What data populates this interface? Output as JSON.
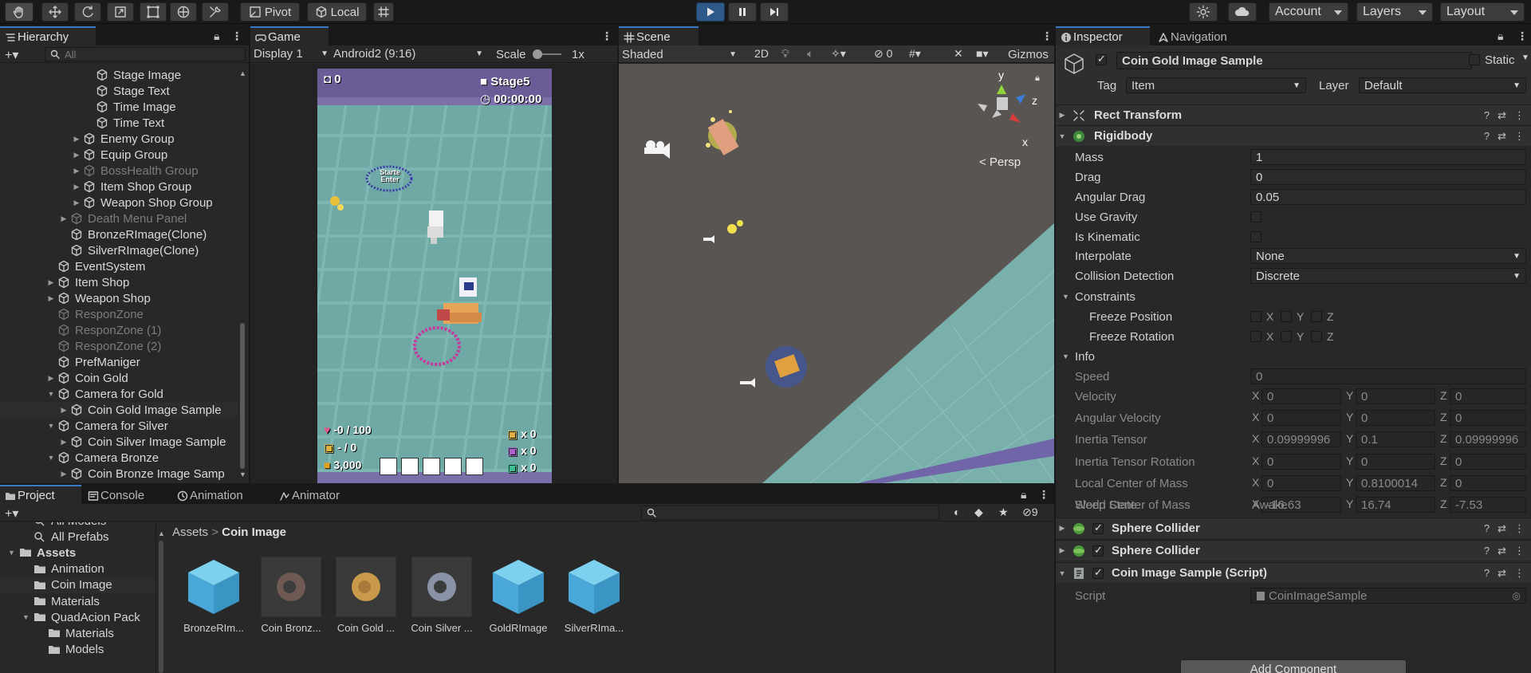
{
  "toolbar": {
    "pivot": "Pivot",
    "local": "Local",
    "account": "Account",
    "layers": "Layers",
    "layout": "Layout"
  },
  "hierarchy": {
    "tab": "Hierarchy",
    "search_placeholder": "All",
    "items": [
      {
        "label": "Stage Image",
        "indent": 3,
        "expand": false,
        "dim": false
      },
      {
        "label": "Stage Text",
        "indent": 3,
        "expand": false,
        "dim": false
      },
      {
        "label": "Time Image",
        "indent": 3,
        "expand": false,
        "dim": false
      },
      {
        "label": "Time Text",
        "indent": 3,
        "expand": false,
        "dim": false
      },
      {
        "label": "Enemy Group",
        "indent": 2,
        "expand": true,
        "dim": false
      },
      {
        "label": "Equip Group",
        "indent": 2,
        "expand": true,
        "dim": false
      },
      {
        "label": "BossHealth Group",
        "indent": 2,
        "expand": true,
        "dim": true
      },
      {
        "label": "Item Shop Group",
        "indent": 2,
        "expand": true,
        "dim": false
      },
      {
        "label": "Weapon Shop Group",
        "indent": 2,
        "expand": true,
        "dim": false
      },
      {
        "label": "Death Menu Panel",
        "indent": 1,
        "expand": true,
        "dim": true
      },
      {
        "label": "BronzeRImage(Clone)",
        "indent": 1,
        "expand": false,
        "dim": false
      },
      {
        "label": "SilverRImage(Clone)",
        "indent": 1,
        "expand": false,
        "dim": false
      },
      {
        "label": "EventSystem",
        "indent": 0,
        "expand": false,
        "dim": false
      },
      {
        "label": "Item Shop",
        "indent": 0,
        "expand": true,
        "dim": false
      },
      {
        "label": "Weapon Shop",
        "indent": 0,
        "expand": true,
        "dim": false
      },
      {
        "label": "ResponZone",
        "indent": 0,
        "expand": false,
        "dim": true
      },
      {
        "label": "ResponZone (1)",
        "indent": 0,
        "expand": false,
        "dim": true
      },
      {
        "label": "ResponZone (2)",
        "indent": 0,
        "expand": false,
        "dim": true
      },
      {
        "label": "PrefManiger",
        "indent": 0,
        "expand": false,
        "dim": false
      },
      {
        "label": "Coin Gold",
        "indent": 0,
        "expand": true,
        "dim": false
      },
      {
        "label": "Camera for Gold",
        "indent": 0,
        "expand": "open",
        "dim": false
      },
      {
        "label": "Coin Gold Image Sample",
        "indent": 1,
        "expand": true,
        "dim": false,
        "sel": true
      },
      {
        "label": "Camera for Silver",
        "indent": 0,
        "expand": "open",
        "dim": false
      },
      {
        "label": "Coin Silver Image Sample",
        "indent": 1,
        "expand": true,
        "dim": false
      },
      {
        "label": "Camera Bronze",
        "indent": 0,
        "expand": "open",
        "dim": false
      },
      {
        "label": "Coin Bronze Image Samp",
        "indent": 1,
        "expand": true,
        "dim": false
      }
    ]
  },
  "game": {
    "tab": "Game",
    "display": "Display 1",
    "resolution": "Android2 (9:16)",
    "scale_label": "Scale",
    "scale_value": "1x",
    "hud_hearts": "0",
    "hud_stage": "Stage5",
    "hud_time": "00:00:00",
    "hud_sign": "Starte Enter",
    "hud_health": "-0 / 100",
    "hud_ammo": "- / 0",
    "hud_coins": "3,000",
    "hud_x1": "x 0",
    "hud_x2": "x 0",
    "hud_x3": "x 0"
  },
  "scene": {
    "tab": "Scene",
    "shading": "Shaded",
    "mode2d": "2D",
    "hidden_count": "0",
    "gizmos": "Gizmos",
    "persp": "< Persp",
    "axis_y": "y",
    "axis_z": "z",
    "axis_x": "x"
  },
  "project": {
    "tabs": [
      "Project",
      "Console",
      "Animation",
      "Animator"
    ],
    "hidden_count": "9",
    "tree": [
      {
        "label": "All Models",
        "indent": 1,
        "icon": "search",
        "cut": true
      },
      {
        "label": "All Prefabs",
        "indent": 1,
        "icon": "search"
      },
      {
        "label": "Assets",
        "indent": 0,
        "icon": "folder",
        "open": true,
        "bold": true
      },
      {
        "label": "Animation",
        "indent": 1,
        "icon": "folder"
      },
      {
        "label": "Coin Image",
        "indent": 1,
        "icon": "folder",
        "sel": true
      },
      {
        "label": "Materials",
        "indent": 1,
        "icon": "folder"
      },
      {
        "label": "QuadAcion Pack",
        "indent": 1,
        "icon": "folder",
        "open": true
      },
      {
        "label": "Materials",
        "indent": 2,
        "icon": "folder"
      },
      {
        "label": "Models",
        "indent": 2,
        "icon": "folder"
      }
    ],
    "breadcrumb_root": "Assets",
    "breadcrumb_leaf": "Coin Image",
    "assets": [
      {
        "label": "BronzeRIm...",
        "kind": "prefab"
      },
      {
        "label": "Coin Bronz...",
        "kind": "bronze"
      },
      {
        "label": "Coin Gold ...",
        "kind": "gold"
      },
      {
        "label": "Coin Silver ...",
        "kind": "silver"
      },
      {
        "label": "GoldRImage",
        "kind": "prefab"
      },
      {
        "label": "SilverRIma...",
        "kind": "prefab"
      }
    ]
  },
  "inspector": {
    "tab": "Inspector",
    "tab2": "Navigation",
    "object_name": "Coin Gold Image Sample",
    "static_label": "Static",
    "tag_label": "Tag",
    "tag_value": "Item",
    "layer_label": "Layer",
    "layer_value": "Default",
    "rect_transform": "Rect Transform",
    "rigidbody": "Rigidbody",
    "mass_label": "Mass",
    "mass": "1",
    "drag_label": "Drag",
    "drag": "0",
    "angdrag_label": "Angular Drag",
    "angdrag": "0.05",
    "usegrav_label": "Use Gravity",
    "kinematic_label": "Is Kinematic",
    "interp_label": "Interpolate",
    "interp": "None",
    "coll_label": "Collision Detection",
    "coll": "Discrete",
    "constraints_label": "Constraints",
    "freezepos_label": "Freeze Position",
    "freezerot_label": "Freeze Rotation",
    "ax_x": "X",
    "ax_y": "Y",
    "ax_z": "Z",
    "info_label": "Info",
    "speed_label": "Speed",
    "speed": "0",
    "vel_label": "Velocity",
    "vel": [
      "0",
      "0",
      "0"
    ],
    "angvel_label": "Angular Velocity",
    "angvel": [
      "0",
      "0",
      "0"
    ],
    "inertia_label": "Inertia Tensor",
    "inertia": [
      "0.09999996",
      "0.1",
      "0.09999996"
    ],
    "inertiarot_label": "Inertia Tensor Rotation",
    "inertiarot": [
      "0",
      "0",
      "0"
    ],
    "lcom_label": "Local Center of Mass",
    "lcom": [
      "0",
      "0.8100014",
      "0"
    ],
    "wcom_label": "World Center of Mass",
    "wcom": [
      "-16.63",
      "16.74",
      "-7.53"
    ],
    "sleep_label": "Sleep State",
    "sleep": "Awake",
    "sphere1": "Sphere Collider",
    "sphere2": "Sphere Collider",
    "script_comp": "Coin Image Sample (Script)",
    "script_label": "Script",
    "script_value": "CoinImageSample",
    "add_component": "Add Component"
  }
}
